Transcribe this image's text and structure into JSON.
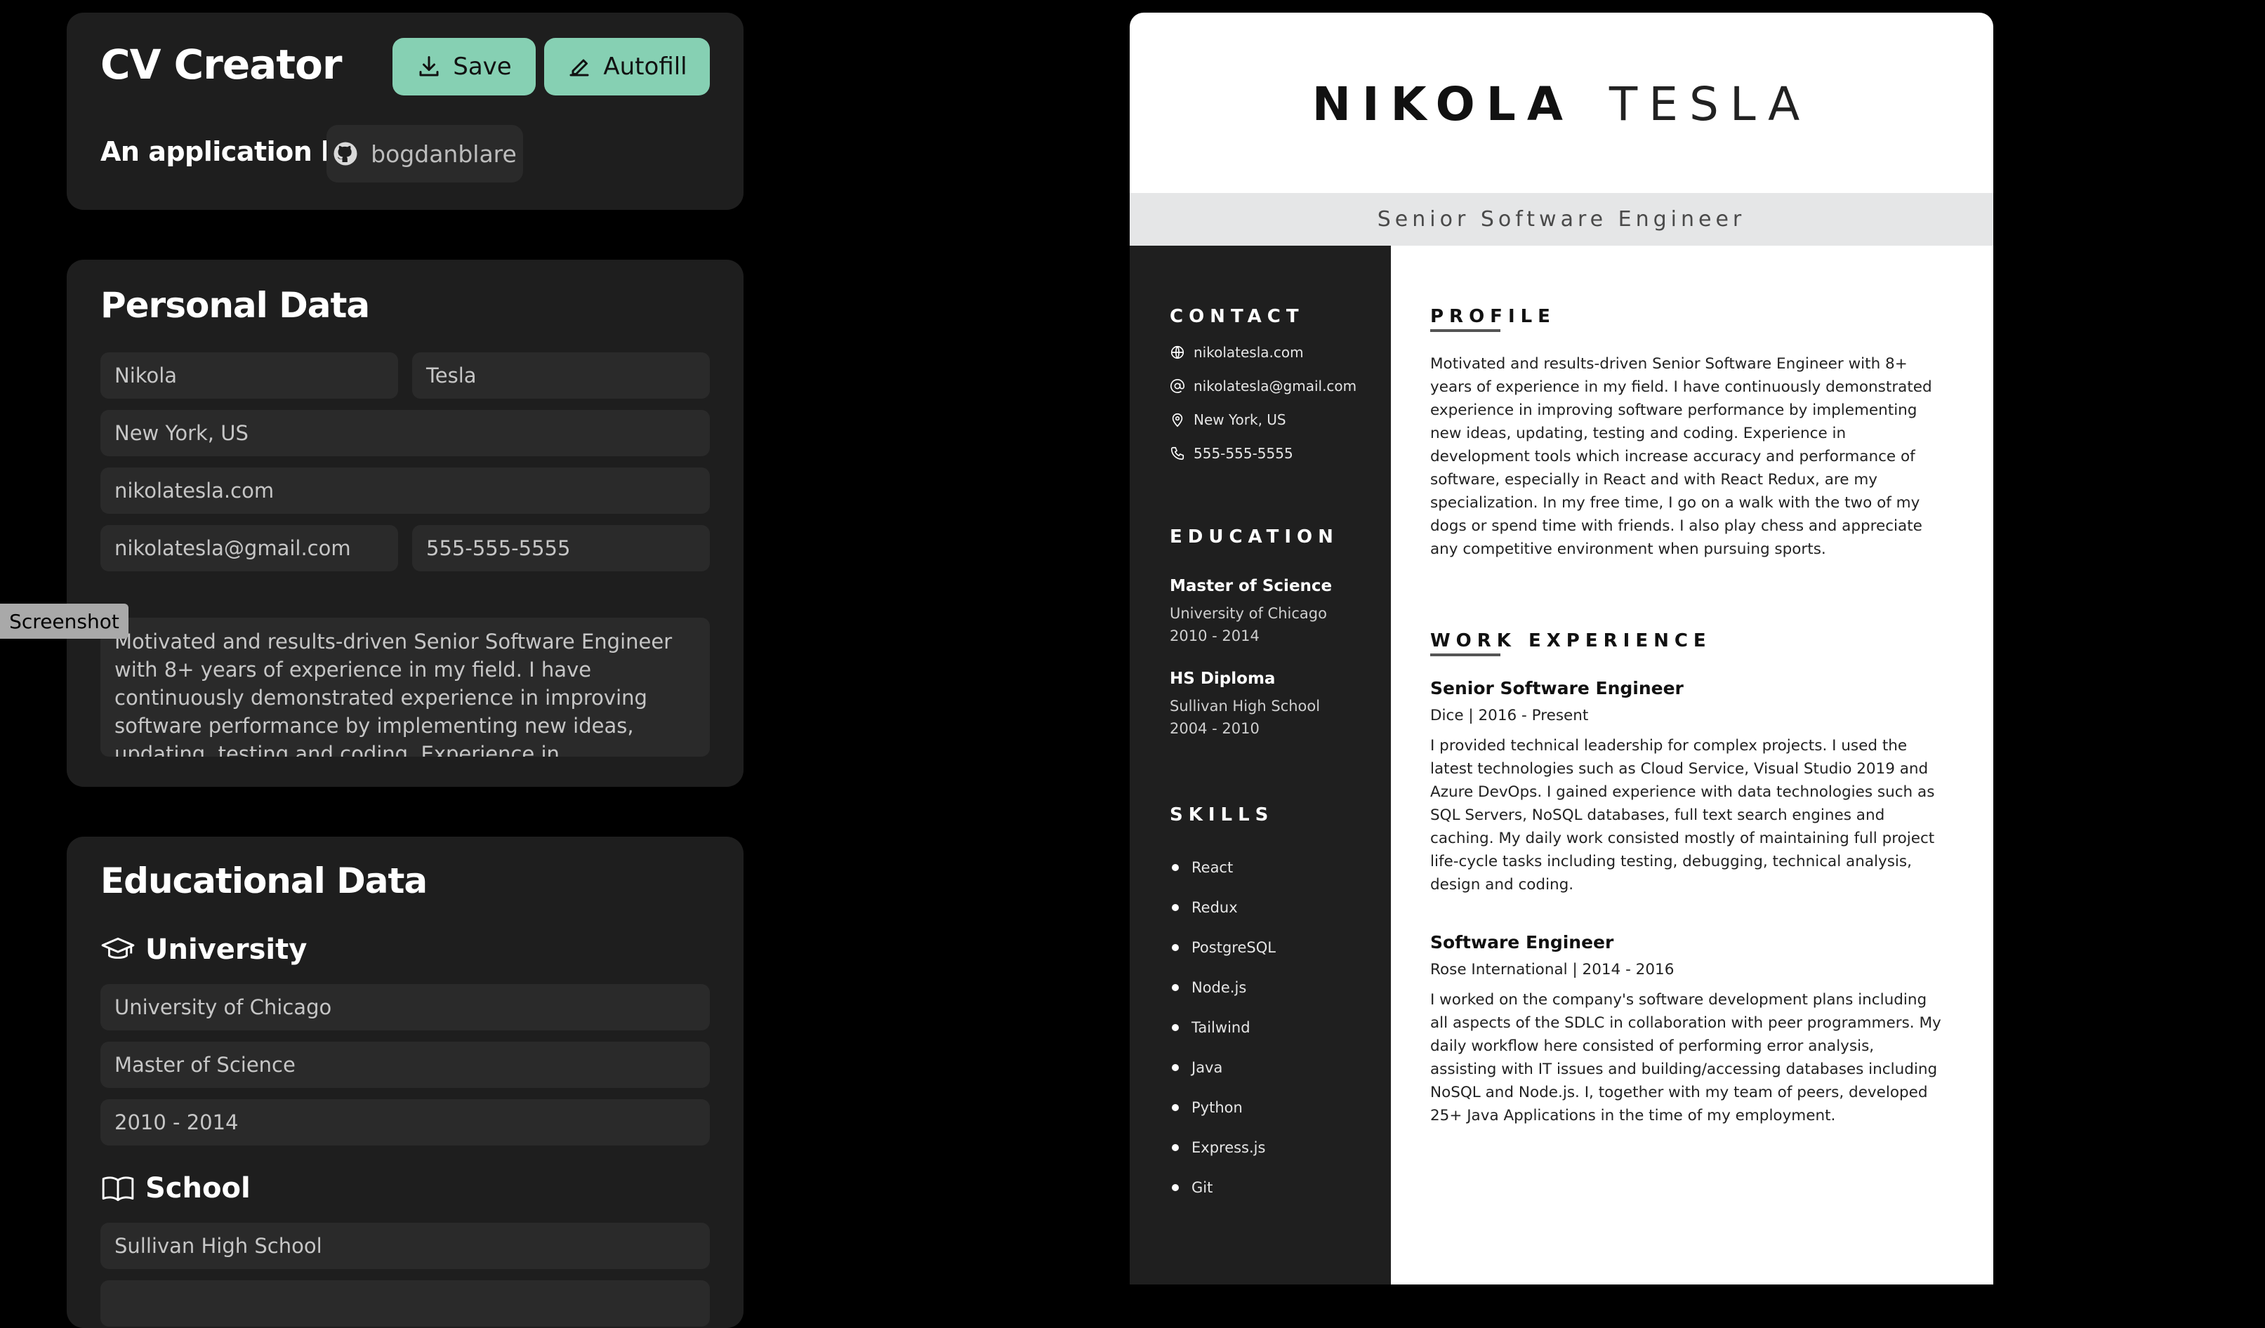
{
  "app": {
    "title": "CV Creator",
    "save_label": "Save",
    "autofill_label": "Autofill",
    "byline": "An application by",
    "github_user": "bogdanblare",
    "accent": "#86d0b3"
  },
  "personal": {
    "title": "Personal Data",
    "first_name": "Nikola",
    "last_name": "Tesla",
    "location": "New York, US",
    "website": "nikolatesla.com",
    "email": "nikolatesla@gmail.com",
    "phone": "555-555-5555",
    "about": "Motivated and results-driven Senior Software Engineer with 8+ years of experience in my field. I have continuously demonstrated experience in improving software performance by implementing new ideas, updating, testing and coding. Experience in development tools which increase accuracy and"
  },
  "education_form": {
    "title": "Educational Data",
    "university_heading": "University",
    "university_name": "University of Chicago",
    "university_degree": "Master of Science",
    "university_years": "2010 - 2014",
    "school_heading": "School",
    "school_name": "Sullivan High School"
  },
  "overlay": {
    "screenshot_label": "Screenshot"
  },
  "cv": {
    "first_name": "NIKOLA",
    "last_name": "TESLA",
    "role": "Senior Software Engineer",
    "contact_heading": "CONTACT",
    "contact": {
      "website": "nikolatesla.com",
      "email": "nikolatesla@gmail.com",
      "location": "New York, US",
      "phone": "555-555-5555"
    },
    "education_heading": "EDUCATION",
    "education": [
      {
        "degree": "Master of Science",
        "school": "University of Chicago",
        "years": "2010 - 2014"
      },
      {
        "degree": "HS Diploma",
        "school": "Sullivan High School",
        "years": "2004 - 2010"
      }
    ],
    "skills_heading": "SKILLS",
    "skills": [
      "React",
      "Redux",
      "PostgreSQL",
      "Node.js",
      "Tailwind",
      "Java",
      "Python",
      "Express.js",
      "Git"
    ],
    "profile_heading": "PROFILE",
    "profile": "Motivated and results-driven Senior Software Engineer with 8+ years of experience in my field. I have continuously demonstrated experience in improving software performance by implementing new ideas, updating, testing and coding. Experience in development tools which increase accuracy and performance of software, especially in React and with React Redux, are my specialization. In my free time, I go on a walk with the two of my dogs or spend time with friends. I also play chess and appreciate any competitive environment when pursuing sports.",
    "work_heading": "WORK EXPERIENCE",
    "jobs": [
      {
        "title": "Senior Software Engineer",
        "meta": "Dice | 2016 - Present",
        "description": "I provided technical leadership for complex projects. I used the latest technologies such as Cloud Service, Visual Studio 2019 and Azure DevOps. I gained experience with data technologies such as SQL Servers, NoSQL databases, full text search engines and caching. My daily work consisted mostly of maintaining full project life-cycle tasks including testing, debugging, technical analysis, design and coding."
      },
      {
        "title": "Software Engineer",
        "meta": "Rose International | 2014 - 2016",
        "description": "I worked on the company's software development plans including all aspects of the SDLC in collaboration with peer programmers. My daily workflow here consisted of performing error analysis, assisting with IT issues and building/accessing databases including NoSQL and Node.js. I, together with my team of peers, developed 25+ Java Applications in the time of my employment."
      }
    ]
  }
}
